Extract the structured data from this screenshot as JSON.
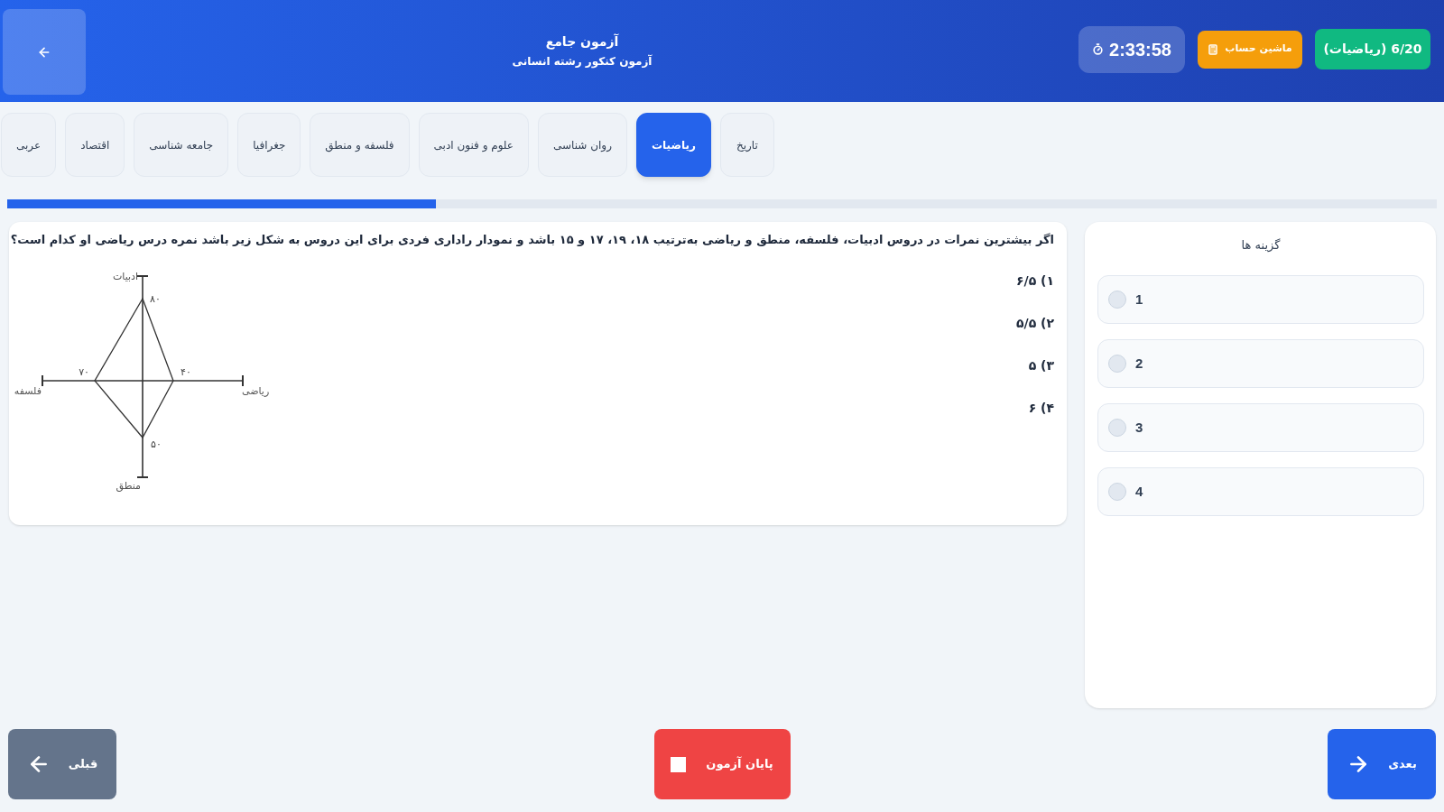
{
  "header": {
    "title": "آزمون جامع",
    "subtitle": "آزمون کنکور رشته انسانی",
    "timer": "2:33:58",
    "calculator_button": "ماشین حساب",
    "progress_badge": "6/20 (ریاضیات)"
  },
  "subject_tabs": [
    {
      "label": "تاریخ",
      "selected": false
    },
    {
      "label": "ریاضیات",
      "selected": true
    },
    {
      "label": "روان شناسی",
      "selected": false
    },
    {
      "label": "علوم و فنون ادبی",
      "selected": false
    },
    {
      "label": "فلسفه و منطق",
      "selected": false
    },
    {
      "label": "جغرافیا",
      "selected": false
    },
    {
      "label": "جامعه شناسی",
      "selected": false
    },
    {
      "label": "اقتصاد",
      "selected": false
    },
    {
      "label": "عربی",
      "selected": false
    }
  ],
  "progress": {
    "level": 0.3
  },
  "question": {
    "text": "اگر بیشترین نمرات در دروس ادبیات، فلسفه، منطق و ریاضی به‌ترتیب ۱۸، ۱۹، ۱۷ و ۱۵ باشد و نمودار راداری فردی برای این دروس به شکل زیر باشد نمره درس ریاضی او کدام است؟",
    "figure": {
      "axes": [
        {
          "label": "ادبیات",
          "value": "۸۰"
        },
        {
          "label": "ریاضی",
          "value": "۴۰"
        },
        {
          "label": "منطق",
          "value": "۵۰"
        },
        {
          "label": "فلسفه",
          "value": "۷۰"
        }
      ]
    },
    "choices": [
      "۱) ۶/۵",
      "۲) ۵/۵",
      "۳) ۵",
      "۴) ۶"
    ]
  },
  "options_panel": {
    "title": "گزینه ها",
    "options": [
      {
        "label": "1",
        "selected": false
      },
      {
        "label": "2",
        "selected": false
      },
      {
        "label": "3",
        "selected": false
      },
      {
        "label": "4",
        "selected": false
      }
    ]
  },
  "footer": {
    "previous_button": "قبلی",
    "finish_button": "پایان آزمون",
    "next_button": "بعدی"
  }
}
